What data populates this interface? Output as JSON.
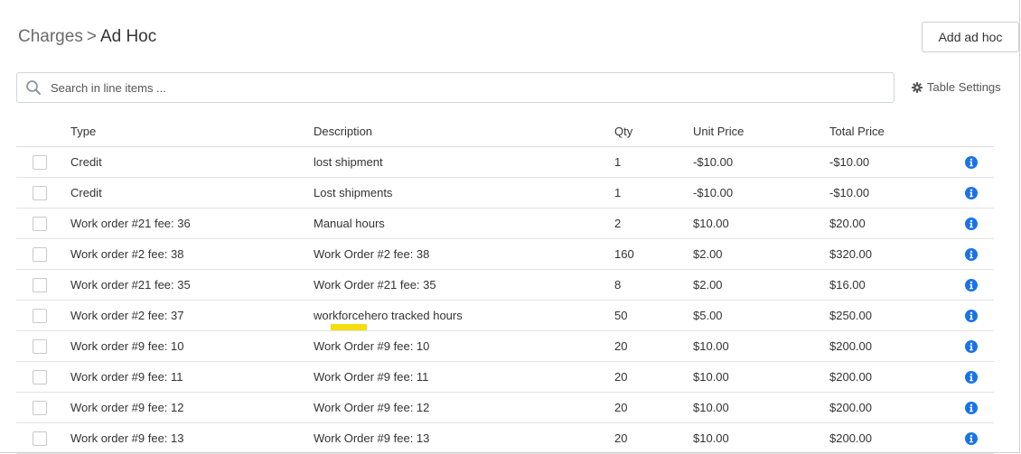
{
  "breadcrumb": {
    "parent": "Charges",
    "separator": ">",
    "current": "Ad Hoc"
  },
  "toolbar": {
    "add_label": "Add ad hoc",
    "table_settings_label": "Table Settings"
  },
  "search": {
    "placeholder": "Search in line items ..."
  },
  "table": {
    "headers": {
      "type": "Type",
      "description": "Description",
      "qty": "Qty",
      "unit_price": "Unit Price",
      "total_price": "Total Price"
    },
    "rows": [
      {
        "type": "Credit",
        "description": "lost shipment",
        "qty": "1",
        "unit_price": "-$10.00",
        "total_price": "-$10.00"
      },
      {
        "type": "Credit",
        "description": "Lost shipments",
        "qty": "1",
        "unit_price": "-$10.00",
        "total_price": "-$10.00"
      },
      {
        "type": "Work order #21 fee: 36",
        "description": "Manual hours",
        "qty": "2",
        "unit_price": "$10.00",
        "total_price": "$20.00"
      },
      {
        "type": "Work order #2 fee: 38",
        "description": "Work Order #2 fee: 38",
        "qty": "160",
        "unit_price": "$2.00",
        "total_price": "$320.00"
      },
      {
        "type": "Work order #21 fee: 35",
        "description": "Work Order #21 fee: 35",
        "qty": "8",
        "unit_price": "$2.00",
        "total_price": "$16.00"
      },
      {
        "type": "Work order #2 fee: 37",
        "description": "workforcehero tracked hours",
        "qty": "50",
        "unit_price": "$5.00",
        "total_price": "$250.00"
      },
      {
        "type": "Work order #9 fee: 10",
        "description": "Work Order #9 fee: 10",
        "qty": "20",
        "unit_price": "$10.00",
        "total_price": "$200.00"
      },
      {
        "type": "Work order #9 fee: 11",
        "description": "Work Order #9 fee: 11",
        "qty": "20",
        "unit_price": "$10.00",
        "total_price": "$200.00"
      },
      {
        "type": "Work order #9 fee: 12",
        "description": "Work Order #9 fee: 12",
        "qty": "20",
        "unit_price": "$10.00",
        "total_price": "$200.00"
      },
      {
        "type": "Work order #9 fee: 13",
        "description": "Work Order #9 fee: 13",
        "qty": "20",
        "unit_price": "$10.00",
        "total_price": "$200.00"
      }
    ]
  },
  "icons": {
    "search": "search-icon",
    "settings": "gear-icon",
    "row_info": "info-icon"
  },
  "colors": {
    "info": "#1a73e8",
    "highlight": "#f4dd10"
  }
}
